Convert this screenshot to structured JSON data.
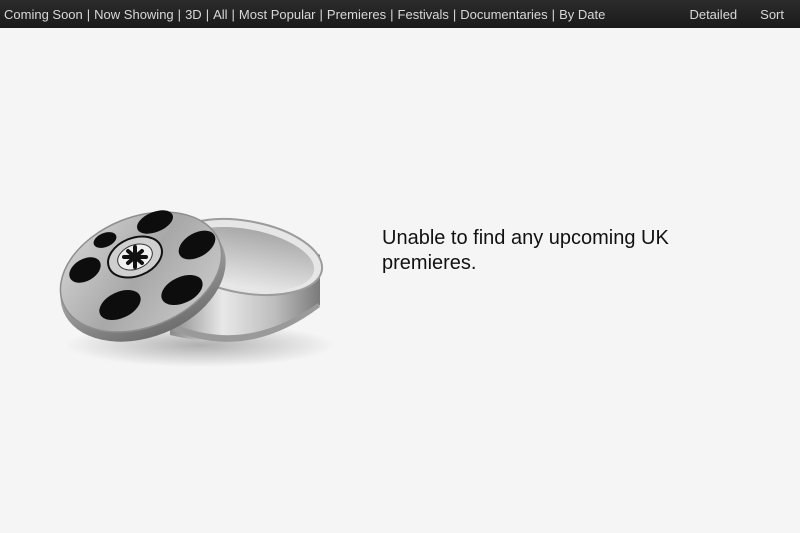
{
  "nav": {
    "items": [
      "Coming Soon",
      "Now Showing",
      "3D",
      "All",
      "Most Popular",
      "Premieres",
      "Festivals",
      "Documentaries",
      "By Date"
    ],
    "separator": "|"
  },
  "actions": {
    "detailed_label": "Detailed",
    "sort_label": "Sort"
  },
  "empty_state": {
    "icon": "film-reel-canister-icon",
    "message": "Unable to find any upcoming UK premieres."
  }
}
